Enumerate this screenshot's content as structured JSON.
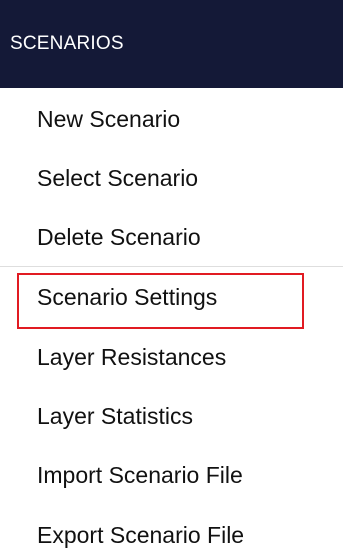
{
  "header": {
    "title": "SCENARIOS",
    "background_color": "#141937"
  },
  "menu": {
    "items": [
      {
        "label": "New Scenario"
      },
      {
        "label": "Select Scenario"
      },
      {
        "label": "Delete Scenario"
      },
      {
        "label": "Scenario Settings",
        "highlighted": true
      },
      {
        "label": "Layer Resistances"
      },
      {
        "label": "Layer Statistics"
      },
      {
        "label": "Import Scenario File"
      },
      {
        "label": "Export Scenario File"
      }
    ],
    "highlight_color": "#e11b22"
  }
}
